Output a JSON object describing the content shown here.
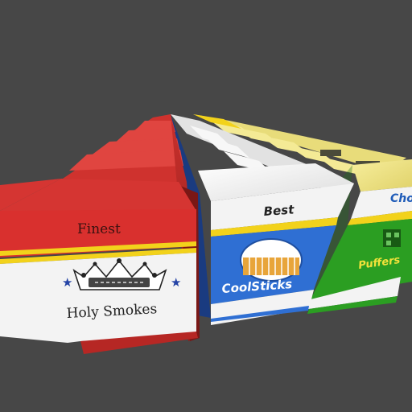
{
  "scene": {
    "background": "#474747",
    "packs": [
      {
        "id": "red",
        "tagline": "Finest",
        "brand": "Holy Smokes",
        "colors": {
          "primary": "#d9302e",
          "dark": "#a82220",
          "stripe": "#f2d21b",
          "panel": "#f3f3f3"
        },
        "emblem": "crown-emblem",
        "accent_icons": [
          "star-icon",
          "star-icon"
        ]
      },
      {
        "id": "blue",
        "tagline": "Best",
        "brand": "CoolSticks",
        "colors": {
          "primary": "#2f6fd3",
          "dark": "#1f4fa0",
          "stripe": "#f2d21b",
          "panel": "#f3f3f3"
        },
        "emblem": "cigarette-badge-icon"
      },
      {
        "id": "green",
        "tagline": "Cho",
        "brand": "Puffers",
        "colors": {
          "primary": "#28a020",
          "dark": "#1d7a18",
          "stripe": "#f2d21b",
          "panel": "#f3f3f3",
          "top": "#efe48a"
        },
        "emblem": "qr-code-icon",
        "top_icon": "barcode-icon"
      }
    ]
  }
}
